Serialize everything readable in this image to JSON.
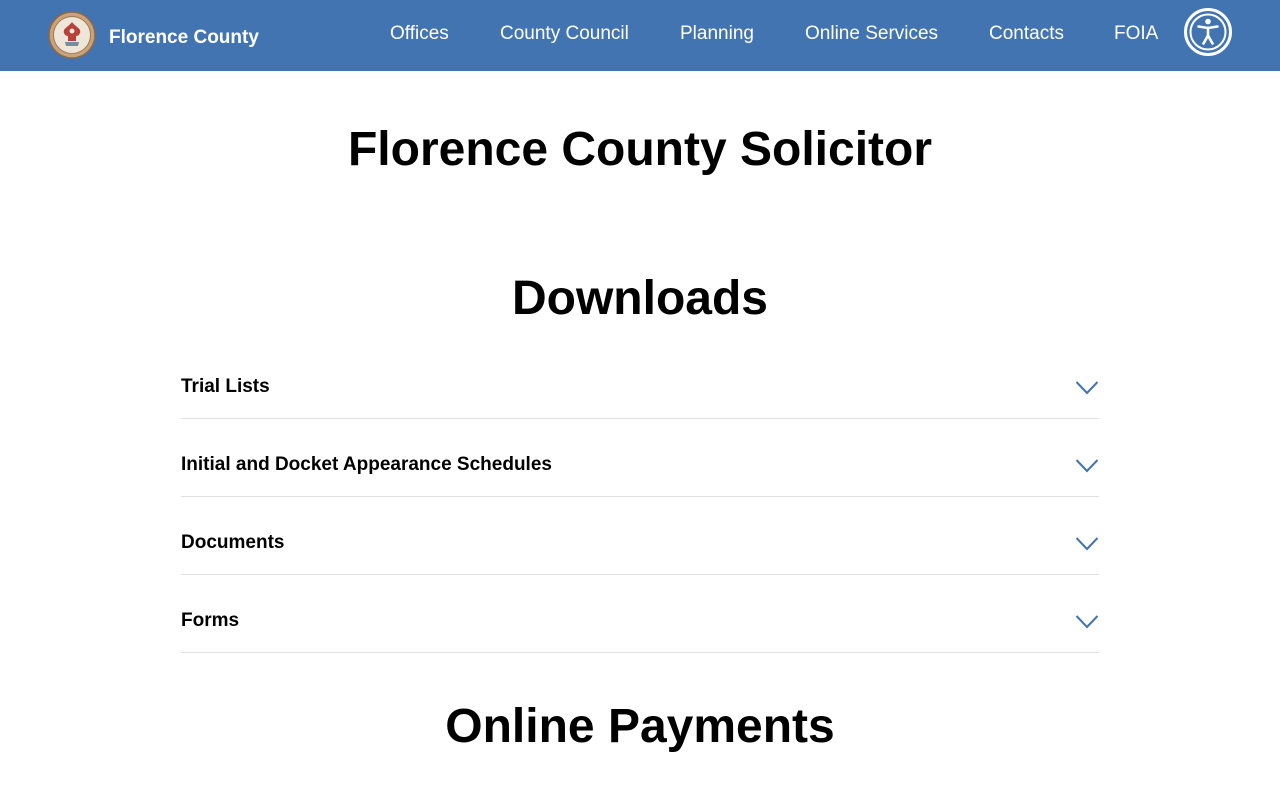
{
  "header": {
    "site_name": "Florence County",
    "nav": [
      {
        "label": "Offices"
      },
      {
        "label": "County Council"
      },
      {
        "label": "Planning"
      },
      {
        "label": "Online Services"
      },
      {
        "label": "Contacts"
      },
      {
        "label": "FOIA"
      }
    ],
    "accessibility_icon": "accessibility-icon",
    "bar_color": "#4374b2"
  },
  "main": {
    "title": "Florence County Solicitor",
    "downloads": {
      "heading": "Downloads",
      "items": [
        {
          "label": "Trial Lists"
        },
        {
          "label": "Initial and Docket Appearance Schedules"
        },
        {
          "label": "Documents"
        },
        {
          "label": "Forms"
        }
      ],
      "chevron_icon": "chevron-down-icon",
      "chevron_color": "#4374b2"
    },
    "payments": {
      "heading": "Online Payments"
    }
  }
}
